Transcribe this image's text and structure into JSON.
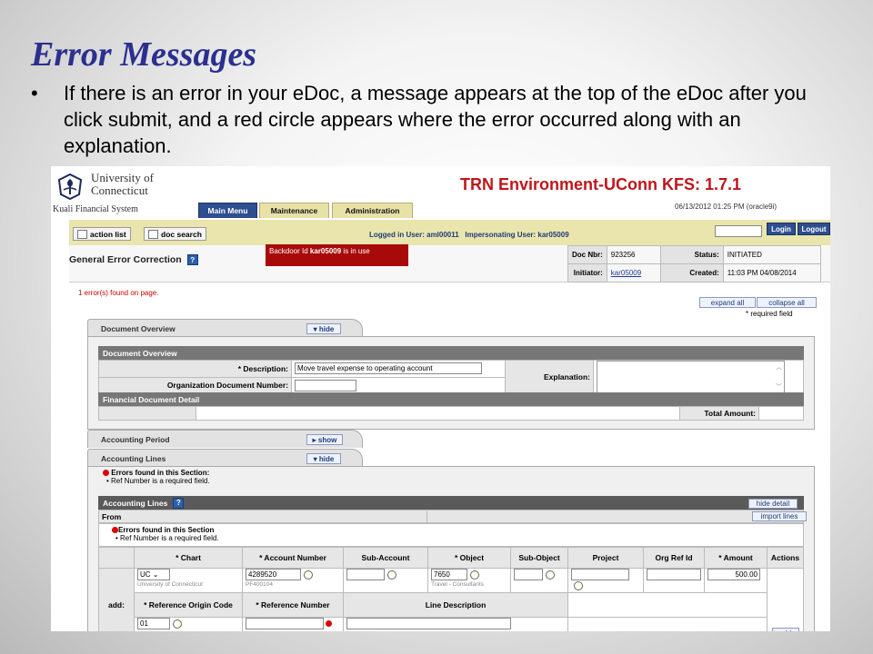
{
  "slide": {
    "title": "Error Messages",
    "bullet": "If there is an error in your eDoc, a message appears at the top of the eDoc after you click submit, and a red circle appears where the error occurred along with an explanation."
  },
  "header": {
    "university_line1": "University of",
    "university_line2": "Connecticut",
    "system_name": "Kuali Financial System",
    "environment": "TRN Environment-UConn KFS: 1.7.1",
    "datetime": "06/13/2012 01:25 PM (oracle9i)"
  },
  "tabs": [
    {
      "label": "Main Menu",
      "active": true
    },
    {
      "label": "Maintenance",
      "active": false
    },
    {
      "label": "Administration",
      "active": false
    }
  ],
  "navbar": {
    "action_list": "action list",
    "doc_search": "doc search",
    "logged_in": "Logged in User: aml00011   Impersonating User: kar05009",
    "login_label": "Login",
    "logout_label": "Logout"
  },
  "document": {
    "type_name": "General Error Correction",
    "help_icon": "?",
    "backdoor_prefix": "Backdoor Id ",
    "backdoor_user": "kar05009",
    "backdoor_suffix": " is in use",
    "doc_nbr_label": "Doc Nbr:",
    "doc_nbr": "923256",
    "status_label": "Status:",
    "status": "INITIATED",
    "initiator_label": "Initiator:",
    "initiator": "kar05009",
    "created_label": "Created:",
    "created": "11:03 PM 04/08/2014"
  },
  "page": {
    "error_count": "1 error(s) found on page.",
    "expand_all": "expand all",
    "collapse_all": "collapse all",
    "required_note": "* required field"
  },
  "doc_overview": {
    "tab_label": "Document Overview",
    "toggle": "hide",
    "section_header": "Document Overview",
    "description_label": "* Description:",
    "description_value": "Move travel expense to operating account",
    "org_doc_label": "Organization Document Number:",
    "explanation_label": "Explanation:",
    "financial_header": "Financial Document Detail",
    "total_amount_label": "Total Amount:"
  },
  "accounting_period": {
    "tab_label": "Accounting Period",
    "toggle": "show"
  },
  "accounting_lines": {
    "tab_label": "Accounting Lines",
    "toggle": "hide",
    "section_errors_title": "Errors found in this Section:",
    "section_error_item": "Ref Number is a required field.",
    "header": "Accounting Lines",
    "hide_detail": "hide detail",
    "from_label": "From",
    "import_lines": "import lines",
    "inner_errors_title": "Errors found in this Section",
    "inner_error_item": "Ref Number is a required field.",
    "columns": [
      "* Chart",
      "* Account Number",
      "Sub-Account",
      "* Object",
      "Sub-Object",
      "Project",
      "Org Ref Id",
      "* Amount",
      "Actions"
    ],
    "add_label": "add:",
    "chart_value": "UC",
    "chart_desc": "University of Connecticut",
    "account_value": "4289520",
    "account_desc": "PF400104",
    "object_value": "7650",
    "object_desc": "Travel - Consultants",
    "amount_value": "500.00",
    "ref_origin_label": "* Reference Origin Code",
    "ref_number_label": "* Reference Number",
    "line_desc_label": "Line Description",
    "ref_origin_value": "01",
    "add_button": "add"
  },
  "colors": {
    "title_blue": "#2b2f8f",
    "env_red": "#c0151b",
    "error_red": "#cc0000",
    "tab_blue": "#2d4e90",
    "nav_yellow": "#e9e5ac"
  }
}
